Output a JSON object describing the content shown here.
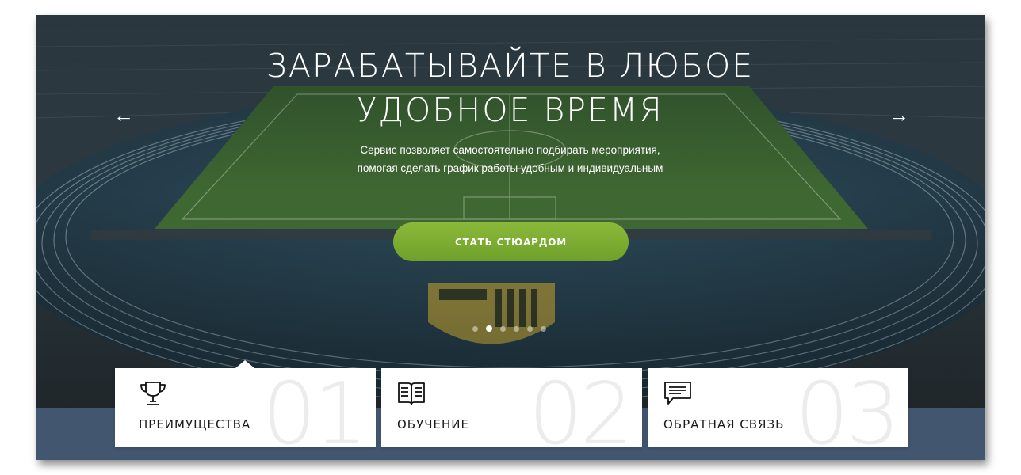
{
  "hero": {
    "title_line1": "ЗАРАБАТЫВАЙТЕ В ЛЮБОЕ",
    "title_line2": "УДОБНОЕ ВРЕМЯ",
    "subtitle_line1": "Сервис позволяет самостоятельно подбирать мероприятия,",
    "subtitle_line2": "помогая сделать график работы удобным и индивидуальным",
    "cta_label": "СТАТЬ СТЮАРДОМ",
    "prev_arrow": "←",
    "next_arrow": "→",
    "slides_count": 6,
    "active_slide": 2
  },
  "cards": [
    {
      "number": "01",
      "label": "ПРЕИМУЩЕСТВА",
      "icon": "trophy-icon"
    },
    {
      "number": "02",
      "label": "ОБУЧЕНИЕ",
      "icon": "book-icon"
    },
    {
      "number": "03",
      "label": "ОБРАТНАЯ СВЯЗЬ",
      "icon": "chat-icon"
    }
  ],
  "colors": {
    "accent_green": "#7cad32",
    "band_blue": "#42566f"
  }
}
